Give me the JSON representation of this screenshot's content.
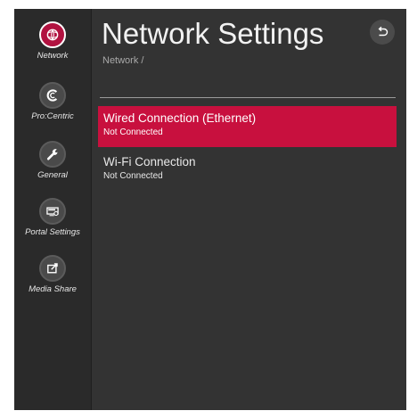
{
  "sidebar": {
    "items": [
      {
        "label": "Network",
        "icon": "globe-icon",
        "active": true
      },
      {
        "label": "Pro:Centric",
        "icon": "procentric-icon",
        "active": false
      },
      {
        "label": "General",
        "icon": "wrench-icon",
        "active": false
      },
      {
        "label": "Portal Settings",
        "icon": "portal-settings-icon",
        "active": false
      },
      {
        "label": "Media Share",
        "icon": "media-share-icon",
        "active": false
      }
    ]
  },
  "header": {
    "title": "Network Settings",
    "breadcrumb": "Network /",
    "back_icon": "back-arrow-icon"
  },
  "connections": [
    {
      "title": "Wired Connection (Ethernet)",
      "status": "Not Connected",
      "selected": true
    },
    {
      "title": "Wi-Fi Connection",
      "status": "Not Connected",
      "selected": false
    }
  ],
  "colors": {
    "accent": "#c8103e",
    "background": "#333333",
    "sidebar": "#2a2a2a"
  }
}
